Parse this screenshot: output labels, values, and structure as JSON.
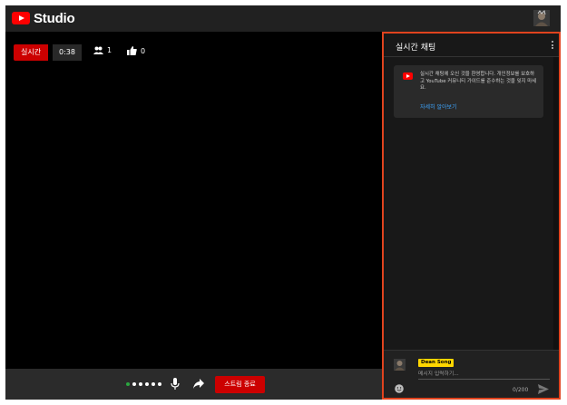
{
  "app": {
    "logo_text": "Studio",
    "brand_color": "#ff0000"
  },
  "stream": {
    "live_label": "실시간",
    "elapsed": "0:38",
    "viewers": "1",
    "likes": "0",
    "end_button_label": "스트림 종료"
  },
  "chat": {
    "title": "실시간 채팅",
    "welcome_text": "실시간 채팅에 오신 것을 환영합니다. 개인정보를 보호하고 YouTube 커뮤니티 가이드를 준수하는 것을 잊지 마세요.",
    "learn_more": "자세히 알아보기",
    "user_name": "Dean Song",
    "input_placeholder": "메시지 입력하기...",
    "char_counter": "0/200",
    "accent_color": "#e0431e"
  },
  "icons": {
    "viewers": "people-icon",
    "likes": "thumbs-up-icon",
    "mic": "microphone-icon",
    "share": "share-arrow-icon",
    "emoji": "emoji-icon",
    "send": "send-icon",
    "menu": "more-vert-icon"
  }
}
